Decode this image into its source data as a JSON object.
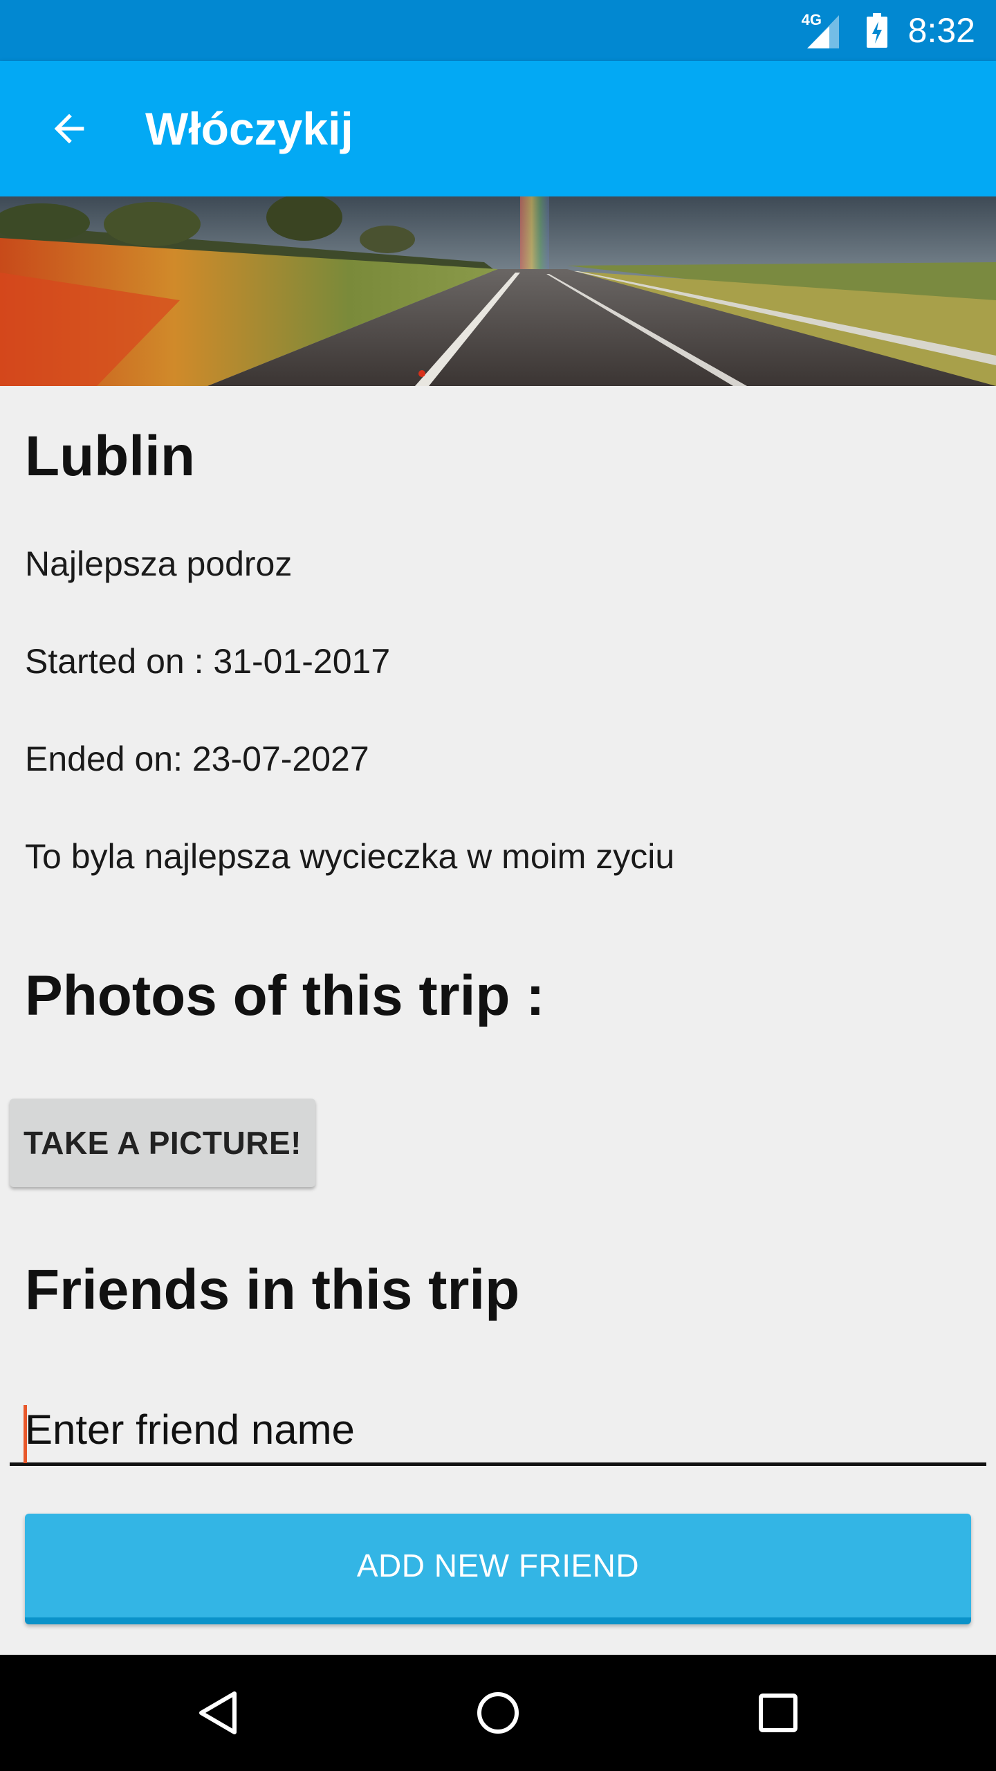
{
  "status_bar": {
    "network": "4G",
    "time": "8:32"
  },
  "app_bar": {
    "title": "Włóczykij",
    "back_icon": "arrow-back-icon",
    "color": "#03a9f4"
  },
  "trip": {
    "name": "Lublin",
    "subtitle": "Najlepsza podroz",
    "started": "Started on : 31-01-2017",
    "ended": "Ended on: 23-07-2027",
    "description": "To byla najlepsza wycieczka w moim zyciu"
  },
  "photos": {
    "heading": "Photos of this trip :",
    "take_picture_label": "TAKE A PICTURE!"
  },
  "friends": {
    "heading": "Friends in this trip",
    "input_placeholder": "Enter friend name",
    "add_button_label": "ADD NEW FRIEND",
    "accent": "#33b5e5"
  },
  "nav_bar": {
    "back_icon": "nav-back-icon",
    "home_icon": "nav-home-icon",
    "recents_icon": "nav-recents-icon"
  }
}
